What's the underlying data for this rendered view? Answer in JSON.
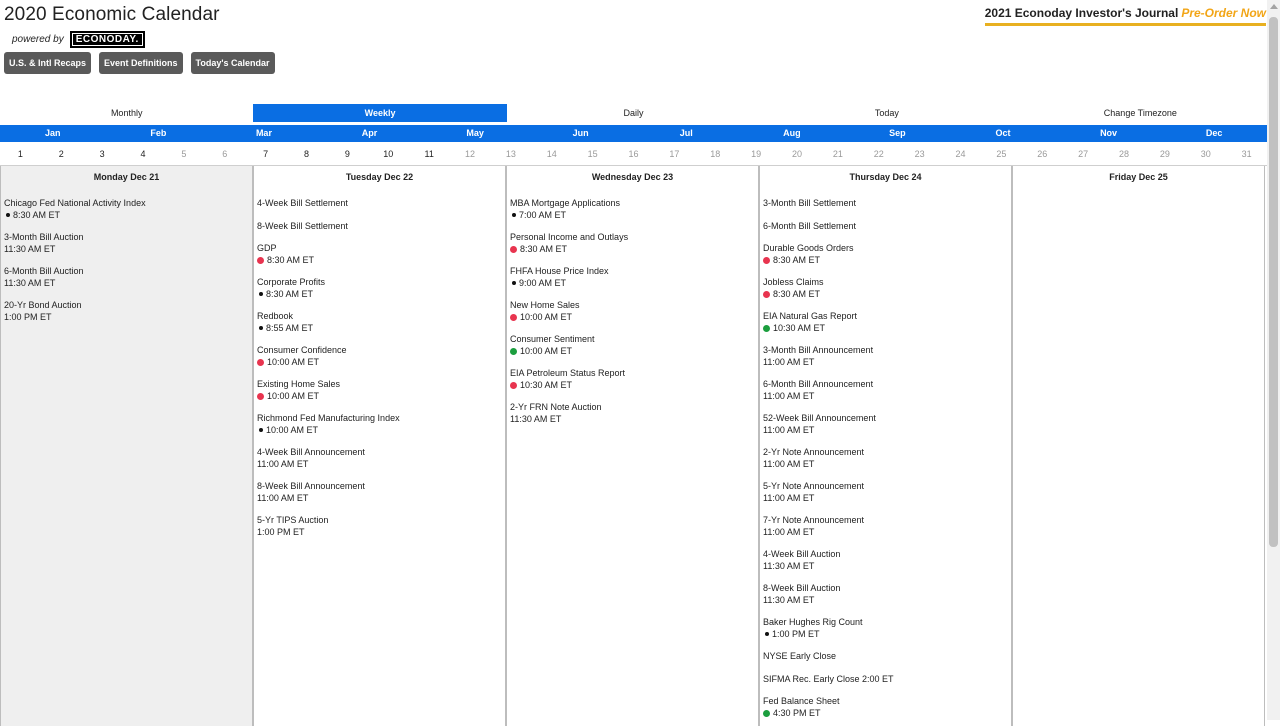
{
  "header": {
    "title": "2020 Economic Calendar",
    "powered_by": "powered by",
    "logo_text": "ECONODAY.",
    "promo_title": "2021 Econoday Investor's Journal",
    "promo_cta": "Pre-Order Now",
    "buttons": [
      "U.S. & Intl Recaps",
      "Event Definitions",
      "Today's Calendar"
    ]
  },
  "view_tabs": [
    "Monthly",
    "Weekly",
    "Daily",
    "Today",
    "Change Timezone"
  ],
  "active_view": "Weekly",
  "months": [
    "Jan",
    "Feb",
    "Mar",
    "Apr",
    "May",
    "Jun",
    "Jul",
    "Aug",
    "Sep",
    "Oct",
    "Nov",
    "Dec"
  ],
  "days": [
    "1",
    "2",
    "3",
    "4",
    "5",
    "6",
    "7",
    "8",
    "9",
    "10",
    "11",
    "12",
    "13",
    "14",
    "15",
    "16",
    "17",
    "18",
    "19",
    "20",
    "21",
    "22",
    "23",
    "24",
    "25",
    "26",
    "27",
    "28",
    "29",
    "30",
    "31"
  ],
  "colors": {
    "accent": "#0a6ee3",
    "high": "#e8344f",
    "medium": "#1b9e3e",
    "low": "#111111",
    "promo": "#f2a516"
  },
  "columns": [
    {
      "heading": "Monday Dec 21",
      "events": [
        {
          "name": "Chicago Fed National Activity Index",
          "time": "8:30 AM ET",
          "dot": "black"
        },
        {
          "name": "3-Month Bill Auction",
          "time": "11:30 AM ET",
          "dot": ""
        },
        {
          "name": "6-Month Bill Auction",
          "time": "11:30 AM ET",
          "dot": ""
        },
        {
          "name": "20-Yr Bond Auction",
          "time": "1:00 PM ET",
          "dot": ""
        }
      ]
    },
    {
      "heading": "Tuesday Dec 22",
      "events": [
        {
          "name": "4-Week Bill Settlement",
          "time": "",
          "dot": ""
        },
        {
          "name": "8-Week Bill Settlement",
          "time": "",
          "dot": ""
        },
        {
          "name": "GDP",
          "time": "8:30 AM ET",
          "dot": "red"
        },
        {
          "name": "Corporate Profits",
          "time": "8:30 AM ET",
          "dot": "black"
        },
        {
          "name": "Redbook",
          "time": "8:55 AM ET",
          "dot": "black"
        },
        {
          "name": "Consumer Confidence",
          "time": "10:00 AM ET",
          "dot": "red"
        },
        {
          "name": "Existing Home Sales",
          "time": "10:00 AM ET",
          "dot": "red"
        },
        {
          "name": "Richmond Fed Manufacturing Index",
          "time": "10:00 AM ET",
          "dot": "black"
        },
        {
          "name": "4-Week Bill Announcement",
          "time": "11:00 AM ET",
          "dot": ""
        },
        {
          "name": "8-Week Bill Announcement",
          "time": "11:00 AM ET",
          "dot": ""
        },
        {
          "name": "5-Yr TIPS Auction",
          "time": "1:00 PM ET",
          "dot": ""
        }
      ]
    },
    {
      "heading": "Wednesday Dec 23",
      "events": [
        {
          "name": "MBA Mortgage Applications",
          "time": "7:00 AM ET",
          "dot": "black"
        },
        {
          "name": "Personal Income and Outlays",
          "time": "8:30 AM ET",
          "dot": "red"
        },
        {
          "name": "FHFA House Price Index",
          "time": "9:00 AM ET",
          "dot": "black"
        },
        {
          "name": "New Home Sales",
          "time": "10:00 AM ET",
          "dot": "red"
        },
        {
          "name": "Consumer Sentiment",
          "time": "10:00 AM ET",
          "dot": "green"
        },
        {
          "name": "EIA Petroleum Status Report",
          "time": "10:30 AM ET",
          "dot": "red"
        },
        {
          "name": "2-Yr FRN Note Auction",
          "time": "11:30 AM ET",
          "dot": ""
        }
      ]
    },
    {
      "heading": "Thursday Dec 24",
      "events": [
        {
          "name": "3-Month Bill Settlement",
          "time": "",
          "dot": ""
        },
        {
          "name": "6-Month Bill Settlement",
          "time": "",
          "dot": ""
        },
        {
          "name": "Durable Goods Orders",
          "time": "8:30 AM ET",
          "dot": "red"
        },
        {
          "name": "Jobless Claims",
          "time": "8:30 AM ET",
          "dot": "red"
        },
        {
          "name": "EIA Natural Gas Report",
          "time": "10:30 AM ET",
          "dot": "green"
        },
        {
          "name": "3-Month Bill Announcement",
          "time": "11:00 AM ET",
          "dot": ""
        },
        {
          "name": "6-Month Bill Announcement",
          "time": "11:00 AM ET",
          "dot": ""
        },
        {
          "name": "52-Week Bill Announcement",
          "time": "11:00 AM ET",
          "dot": ""
        },
        {
          "name": "2-Yr Note Announcement",
          "time": "11:00 AM ET",
          "dot": ""
        },
        {
          "name": "5-Yr Note Announcement",
          "time": "11:00 AM ET",
          "dot": ""
        },
        {
          "name": "7-Yr Note Announcement",
          "time": "11:00 AM ET",
          "dot": ""
        },
        {
          "name": "4-Week Bill Auction",
          "time": "11:30 AM ET",
          "dot": ""
        },
        {
          "name": "8-Week Bill Auction",
          "time": "11:30 AM ET",
          "dot": ""
        },
        {
          "name": "Baker Hughes Rig Count",
          "time": "1:00 PM ET",
          "dot": "black"
        },
        {
          "name": "NYSE Early Close",
          "time": "",
          "dot": ""
        },
        {
          "name": "SIFMA Rec. Early Close 2:00 ET",
          "time": "",
          "dot": ""
        },
        {
          "name": "Fed Balance Sheet",
          "time": "4:30 PM ET",
          "dot": "green"
        }
      ]
    },
    {
      "heading": "Friday Dec 25",
      "events": []
    }
  ]
}
